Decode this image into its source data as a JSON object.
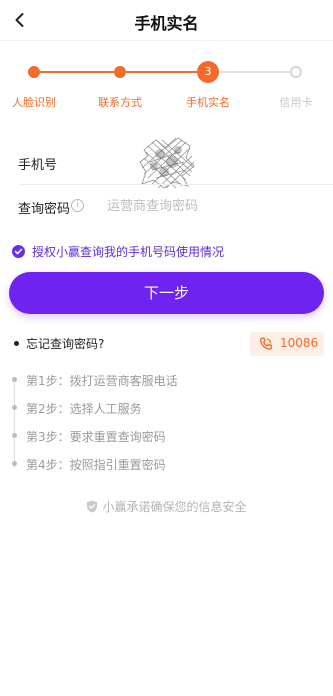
{
  "header": {
    "title": "手机实名"
  },
  "stepper": {
    "steps": [
      {
        "label": "人脸识别",
        "state": "done"
      },
      {
        "label": "联系方式",
        "state": "done"
      },
      {
        "label": "手机实名",
        "state": "current",
        "number": "3"
      },
      {
        "label": "信用卡",
        "state": "todo"
      }
    ],
    "colors": {
      "active": "#f26b2b",
      "inactive": "#d6d6d6"
    }
  },
  "form": {
    "phone_label": "手机号",
    "password_label": "查询密码",
    "password_placeholder": "运营商查询密码",
    "info_icon": "i"
  },
  "authorize": {
    "text": "授权小赢查询我的手机号码使用情况",
    "checked": true
  },
  "next_button": {
    "label": "下一步",
    "color": "#6f23f0"
  },
  "forgot": {
    "text": "忘记查询密码?",
    "hotline": "10086"
  },
  "guide": {
    "steps": [
      "第1步：拨打运营商客服电话",
      "第2步：选择人工服务",
      "第3步：要求重置查询密码",
      "第4步：按照指引重置密码"
    ]
  },
  "security": {
    "text": "小赢承诺确保您的信息安全"
  }
}
